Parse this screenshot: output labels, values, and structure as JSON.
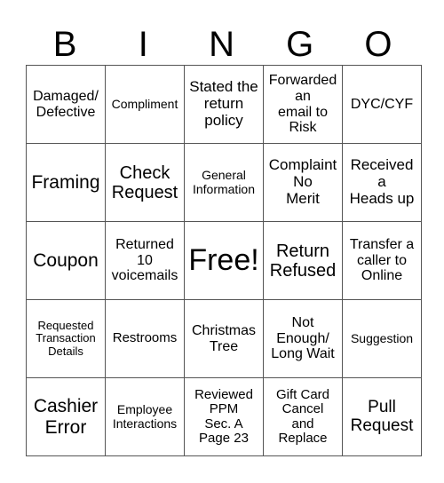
{
  "header": [
    "B",
    "I",
    "N",
    "G",
    "O"
  ],
  "rows": [
    [
      {
        "text": "Damaged/\nDefective",
        "size": "s16"
      },
      {
        "text": "Compliment",
        "size": "s14"
      },
      {
        "text": "Stated the\nreturn\npolicy",
        "size": "s17"
      },
      {
        "text": "Forwarded\nan\nemail to\nRisk",
        "size": "s16"
      },
      {
        "text": "DYC/CYF",
        "size": "s16"
      }
    ],
    [
      {
        "text": "Framing",
        "size": "s21"
      },
      {
        "text": "Check\nRequest",
        "size": "s20"
      },
      {
        "text": "General\nInformation",
        "size": "s14"
      },
      {
        "text": "Complaint\nNo\nMerit",
        "size": "s17"
      },
      {
        "text": "Received\na\nHeads up",
        "size": "s17"
      }
    ],
    [
      {
        "text": "Coupon",
        "size": "s21"
      },
      {
        "text": "Returned\n10\nvoicemails",
        "size": "s16"
      },
      {
        "text": "Free!",
        "size": "s34"
      },
      {
        "text": "Return\nRefused",
        "size": "s20"
      },
      {
        "text": "Transfer a\ncaller to\nOnline",
        "size": "s16"
      }
    ],
    [
      {
        "text": "Requested\nTransaction\nDetails",
        "size": "s13"
      },
      {
        "text": "Restrooms",
        "size": "s15"
      },
      {
        "text": "Christmas\nTree",
        "size": "s16"
      },
      {
        "text": "Not\nEnough/\nLong Wait",
        "size": "s16"
      },
      {
        "text": "Suggestion",
        "size": "s14"
      }
    ],
    [
      {
        "text": "Cashier\nError",
        "size": "s21"
      },
      {
        "text": "Employee\nInteractions",
        "size": "s14"
      },
      {
        "text": "Reviewed\nPPM\nSec. A\nPage 23",
        "size": "s15"
      },
      {
        "text": "Gift Card\nCancel\nand\nReplace",
        "size": "s15"
      },
      {
        "text": "Pull\nRequest",
        "size": "s19"
      }
    ]
  ]
}
